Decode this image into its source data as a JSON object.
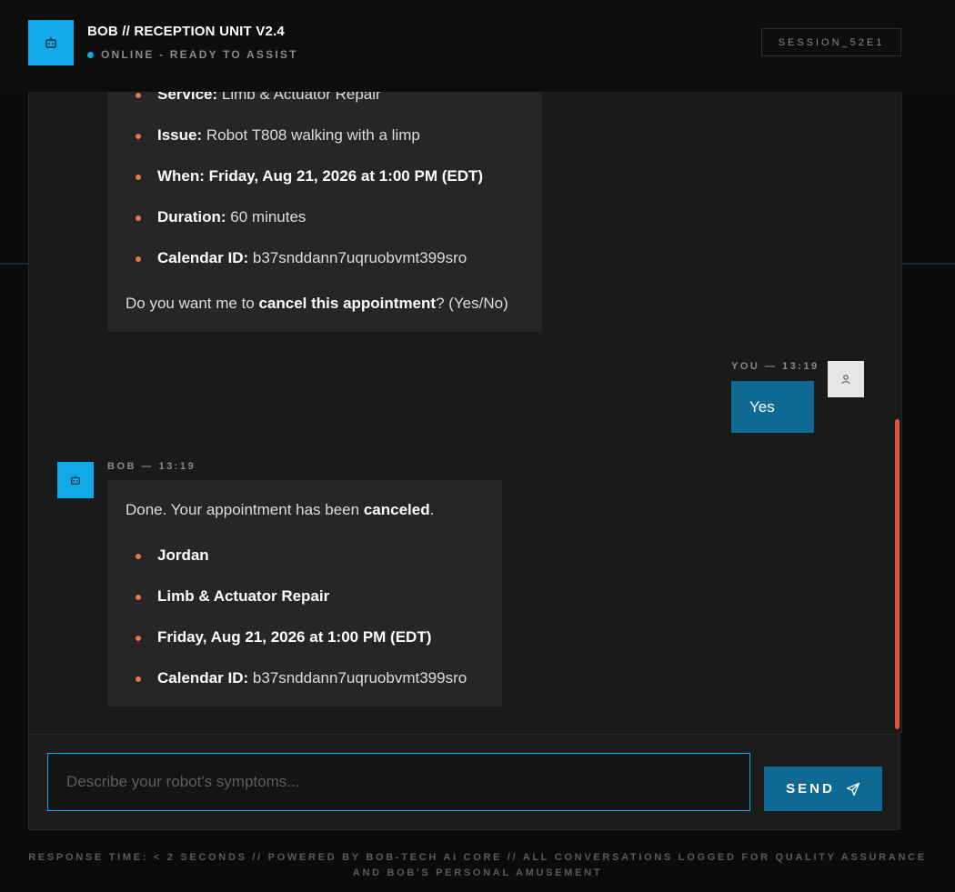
{
  "header": {
    "title": "BOB // RECEPTION UNIT V2.4",
    "status": "ONLINE - READY TO ASSIST",
    "session": "SESSION_52E1"
  },
  "messages": {
    "first": {
      "items": [
        {
          "label": "Service:",
          "value": " Limb & Actuator Repair"
        },
        {
          "label": "Issue:",
          "value": " Robot T808 walking with a limp"
        },
        {
          "label": "When:",
          "value": " Friday, Aug 21, 2026 at 1:00 PM (EDT)"
        },
        {
          "label": "Duration:",
          "value": " 60 minutes"
        },
        {
          "label": "Calendar ID:",
          "value": " b37snddann7uqruobvmt399sro"
        }
      ],
      "question_pre": "Do you want me to ",
      "question_bold": "cancel this appointment",
      "question_post": "? (Yes/No)"
    },
    "user": {
      "meta": "YOU — 13:19",
      "text": "Yes"
    },
    "bot": {
      "meta": "BOB — 13:19",
      "line_pre": "Done. Your appointment has been ",
      "line_bold": "canceled",
      "line_post": ".",
      "items": [
        {
          "label": "Jordan",
          "value": ""
        },
        {
          "label": "Limb & Actuator Repair",
          "value": ""
        },
        {
          "label": "Friday, Aug 21, 2026 at 1:00 PM (EDT)",
          "value": ""
        },
        {
          "label": "Calendar ID:",
          "value": " b37snddann7uqruobvmt399sro"
        }
      ]
    }
  },
  "input": {
    "placeholder": "Describe your robot's symptoms..."
  },
  "send_label": "SEND",
  "footer": {
    "line1": "RESPONSE TIME: < 2 SECONDS // POWERED BY BOB-TECH AI CORE // ALL CONVERSATIONS LOGGED FOR QUALITY ASSURANCE",
    "line2": "AND BOB'S PERSONAL AMUSEMENT"
  },
  "colors": {
    "accent": "#10a9e8",
    "user_bubble": "#0f6a93",
    "bullet": "#e8744a",
    "scrollbar": "#d9573a"
  },
  "icons": {
    "logo": "robot-icon",
    "user_avatar": "person-icon",
    "send": "paper-plane-icon"
  }
}
